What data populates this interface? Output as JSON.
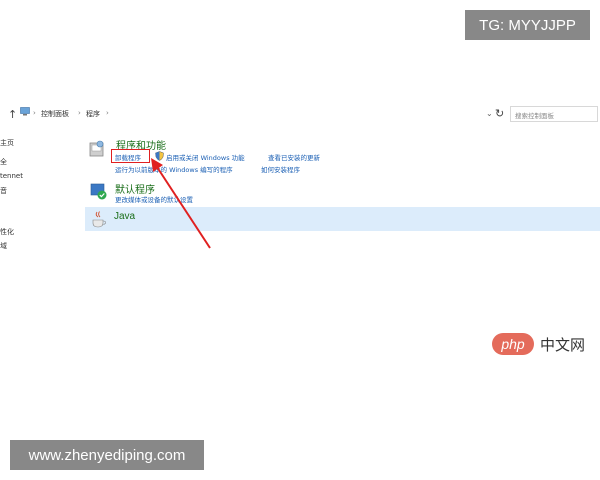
{
  "watermark_top": "TG: MYYJJPP",
  "watermark_bottom": "www.zhenyediping.com",
  "address_bar": {
    "breadcrumbs": [
      "控制面板",
      "程序"
    ],
    "search_placeholder": "搜索控制面板"
  },
  "left_nav": [
    "主页",
    "全",
    "tennet",
    "音",
    "性化",
    "域"
  ],
  "categories": [
    {
      "title": "程序和功能",
      "links": [
        "卸载程序",
        "启用或关闭 Windows 功能",
        "查看已安装的更新",
        "运行为以前版本的 Windows 编写的程序",
        "如何安装程序"
      ]
    },
    {
      "title": "默认程序",
      "links": [
        "更改媒体或设备的默认设置"
      ]
    },
    {
      "title": "Java",
      "links": []
    }
  ],
  "php_logo": {
    "badge": "php",
    "text": "中文网"
  },
  "colors": {
    "link": "#1a5fb4",
    "title": "#1a6e1a",
    "highlight": "#e02020",
    "arrow": "#e02020",
    "java_bar": "#dcecfb"
  },
  "icons": [
    "up-arrow-icon",
    "computer-icon",
    "refresh-icon",
    "programs-icon",
    "shield-icon",
    "default-programs-icon",
    "java-icon"
  ]
}
